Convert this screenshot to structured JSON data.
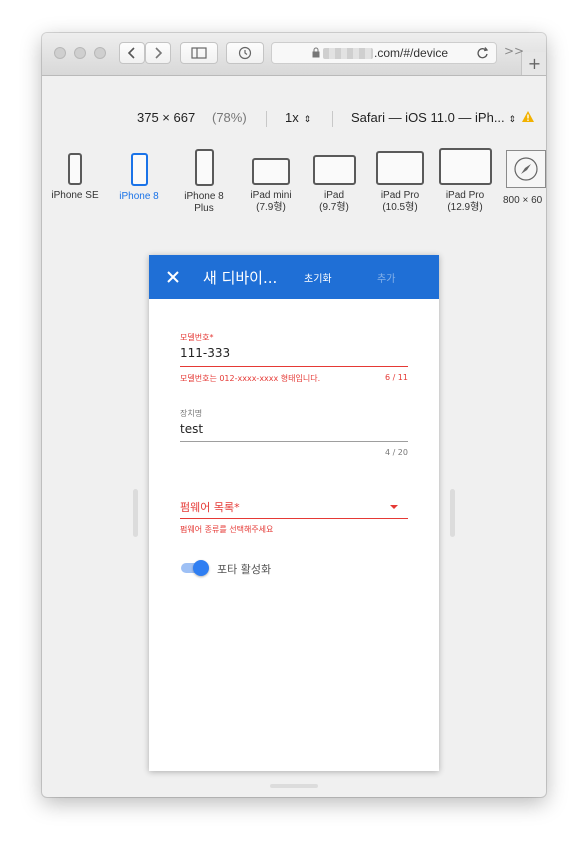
{
  "browser": {
    "url": ".com/#/device",
    "colors": {
      "titlebar": "#e4e4e4",
      "accent": "#1a73e8"
    }
  },
  "responsive_toolbar": {
    "dimensions": "375 × 667",
    "zoom_percent": "(78%)",
    "pixel_ratio": "1x",
    "user_agent": "Safari — iOS 11.0 — iPh...",
    "warning_icon": "warning-icon"
  },
  "devices": [
    {
      "name": "iPhone SE",
      "line2": "",
      "active": false
    },
    {
      "name": "iPhone 8",
      "line2": "",
      "active": true
    },
    {
      "name": "iPhone 8",
      "line2": "Plus",
      "active": false
    },
    {
      "name": "iPad mini",
      "line2": "(7.9형)",
      "active": false
    },
    {
      "name": "iPad",
      "line2": "(9.7형)",
      "active": false
    },
    {
      "name": "iPad Pro",
      "line2": "(10.5형)",
      "active": false
    },
    {
      "name": "iPad Pro",
      "line2": "(12.9형)",
      "active": false
    },
    {
      "name": "800 × 60",
      "line2": "",
      "active": false
    }
  ],
  "app": {
    "appbar": {
      "title": "새 디바이...",
      "reset_label": "초기화",
      "add_label": "추가",
      "color": "#1f6fd6"
    },
    "model_field": {
      "label": "모델번호*",
      "value": "111-333",
      "helper": "모델번호는 012-xxxx-xxxx 형태입니다.",
      "counter": "6 / 11",
      "error_color": "#e53935"
    },
    "device_name_field": {
      "label": "장치명",
      "value": "test",
      "counter": "4 / 20"
    },
    "firmware_field": {
      "label": "펌웨어 목록*",
      "helper": "펌웨어 종류를 선택해주세요"
    },
    "portal_toggle": {
      "label": "포타 활성화",
      "on": true
    }
  }
}
